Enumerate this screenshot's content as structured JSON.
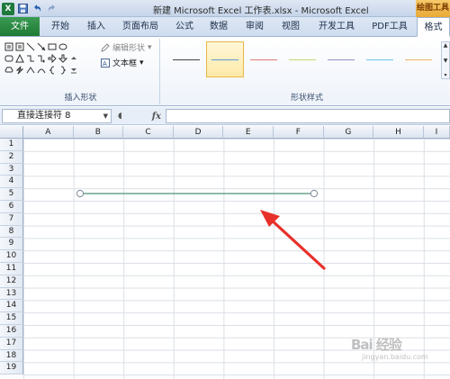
{
  "window": {
    "title": "新建 Microsoft Excel 工作表.xlsx - Microsoft Excel",
    "context_label": "绘图工具"
  },
  "quick_access": {
    "app_icon": "X",
    "icons": [
      "excel-logo-icon",
      "save-icon",
      "undo-icon",
      "redo-icon"
    ]
  },
  "tabs": {
    "file": "文件",
    "items": [
      "开始",
      "插入",
      "页面布局",
      "公式",
      "数据",
      "审阅",
      "视图",
      "开发工具",
      "PDF工具",
      "格式"
    ],
    "active_index": 9
  },
  "ribbon": {
    "insert_shapes": {
      "group_label": "插入形状",
      "edit_shape_label": "编辑形状",
      "text_box_label": "文本框"
    },
    "shape_styles": {
      "group_label": "形状样式",
      "swatch_colors": [
        "#444444",
        "#5b9bd5",
        "#e07b76",
        "#c9d672",
        "#9a8fc3",
        "#6fc3df",
        "#f2b56b"
      ],
      "selected_index": 1
    }
  },
  "formula_bar": {
    "name_box": "直接连接符 8",
    "fx_label": "fx",
    "formula": ""
  },
  "sheet": {
    "columns": [
      "A",
      "B",
      "C",
      "D",
      "E",
      "F",
      "G",
      "H",
      "I"
    ],
    "rows": [
      "1",
      "2",
      "3",
      "4",
      "5",
      "6",
      "7",
      "8",
      "9",
      "10",
      "11",
      "12",
      "13",
      "14",
      "15",
      "16",
      "17",
      "18",
      "19"
    ],
    "line_color": "#4e8f7a",
    "arrow_color": "#e8302a"
  },
  "watermark": {
    "brand": "Bai 经验",
    "sub": "jingyan.baidu.com"
  }
}
